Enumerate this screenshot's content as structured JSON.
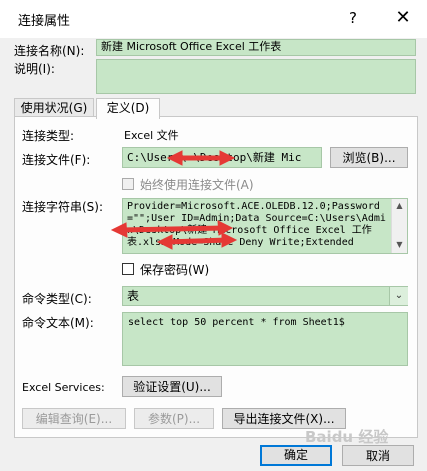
{
  "window": {
    "title": "连接属性",
    "help": "?",
    "close": "✕"
  },
  "connection_name": {
    "label": "连接名称(N):",
    "value": "新建 Microsoft Office Excel 工作表"
  },
  "description": {
    "label": "说明(I):",
    "value": ""
  },
  "tabs": [
    {
      "label": "使用状况(G)",
      "active": false
    },
    {
      "label": "定义(D)",
      "active": true
    }
  ],
  "definition": {
    "connection_type_label": "连接类型:",
    "connection_type_value": "Excel 文件",
    "connection_file_label": "连接文件(F):",
    "connection_file_value": "C:\\Users\\   \\Desktop\\新建 Mic",
    "browse_button": "浏览(B)...",
    "always_use_file_label": "始终使用连接文件(A)",
    "connection_string_label": "连接字符串(S):",
    "connection_string_value": "Provider=Microsoft.ACE.OLEDB.12.0;Password=\"\";User ID=Admin;Data Source=C:\\Users\\Admin\\Desktop\\新建 Microsoft Office Excel 工作表.xlsx;Mode=Share Deny Write;Extended",
    "save_password_label": "保存密码(W)",
    "command_type_label": "命令类型(C):",
    "command_type_value": "表",
    "command_text_label": "命令文本(M):",
    "command_text_value": "select top 50 percent * from Sheet1$",
    "excel_services_label": "Excel Services:",
    "auth_settings_button": "验证设置(U)...",
    "edit_query_button": "编辑查询(E)...",
    "parameters_button": "参数(P)...",
    "export_connection_button": "导出连接文件(X)..."
  },
  "footer": {
    "ok_button": "确定",
    "cancel_button": "取消"
  },
  "watermark": "Baidu 经验",
  "colors": {
    "field_bg": "#c7e6c7",
    "annotation_arrow": "#e53935"
  }
}
